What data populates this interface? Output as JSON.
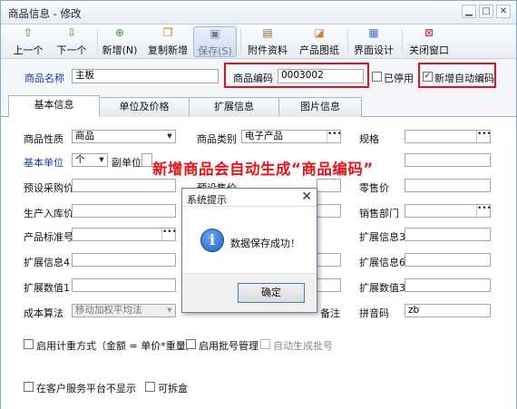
{
  "window": {
    "title": "商品信息 - 修改",
    "controls": [
      "▁",
      "□",
      "✕"
    ]
  },
  "toolbar": [
    {
      "label": "上一个",
      "icon": "up-arrow-icon",
      "glyph": "⇧",
      "color": "#2a9a2a"
    },
    {
      "label": "下一个",
      "icon": "down-arrow-icon",
      "glyph": "⇩",
      "color": "#2a9a2a"
    },
    {
      "label": "新增(N)",
      "icon": "add-icon",
      "glyph": "⊕",
      "color": "#2a9a2a"
    },
    {
      "label": "复制新增",
      "icon": "copy-icon",
      "glyph": "❐",
      "color": "#c07b18"
    },
    {
      "label": "保存(S)",
      "icon": "save-icon",
      "glyph": "▣",
      "color": "#6b7ea6"
    },
    {
      "label": "附件资料",
      "icon": "attachment-icon",
      "glyph": "▤",
      "color": "#8a6f3e"
    },
    {
      "label": "产品图纸",
      "icon": "drawing-icon",
      "glyph": "◪",
      "color": "#d9822b"
    },
    {
      "label": "界面设计",
      "icon": "layout-icon",
      "glyph": "▦",
      "color": "#3f78c7"
    },
    {
      "label": "关闭窗口",
      "icon": "close-window-icon",
      "glyph": "⊠",
      "color": "#c8302a"
    }
  ],
  "header": {
    "name_label": "商品名称",
    "name_value": "主板",
    "code_label": "商品编码",
    "code_value": "0003002",
    "disabled_label": "已停用",
    "disabled_checked": false,
    "autocode_label": "新增自动编码",
    "autocode_checked": true
  },
  "tabs": [
    "基本信息",
    "单位及价格",
    "扩展信息",
    "图片信息"
  ],
  "form": {
    "nature_label": "商品性质",
    "nature_value": "商品",
    "category_label": "商品类别",
    "category_value": "电子产品",
    "spec_label": "规格",
    "spec_value": "",
    "unit_label": "基本单位",
    "unit_value": "个",
    "subunit_label": "副单位",
    "purchase_label": "预设采购价",
    "sale_label": "预设售价",
    "retail_label": "零售价",
    "stockin_label": "生产入库价",
    "dept_label": "销售部门",
    "std_label": "产品标准号",
    "ext3_label": "扩展信息3",
    "ext4_label": "扩展信息4",
    "ext6_label": "扩展信息6",
    "num1_label": "扩展数值1",
    "num3_label": "扩展数值3",
    "algo_label": "成本算法",
    "algo_value": "移动加权平均法",
    "note_label": "备注",
    "pinyin_label": "拼音码",
    "pinyin_value": "zb",
    "measure_label": "启用计重方式（金额 = 单价*重量）",
    "batch_label": "启用批号管理",
    "autobatch_label": "自动生成批号",
    "hide_label": "在客户服务平台不显示",
    "split_label": "可拆盒"
  },
  "annotation": "新增商品会自动生成“商品编码”",
  "dialog": {
    "title": "系统提示",
    "close": "✕",
    "message": "数据保存成功！",
    "icon": "i",
    "ok": "确定"
  },
  "colors": {
    "accent_blue": "#1a3fb8",
    "highlight_red": "#e0141a"
  }
}
